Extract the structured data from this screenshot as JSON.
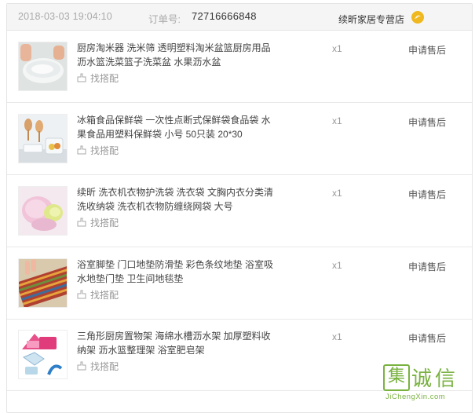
{
  "order": {
    "date": "2018-03-03 19:04:10",
    "number_label": "订单号:",
    "number": "72716666848",
    "shop_name": "续昕家居专营店",
    "shop_icon": "shop-badge-icon"
  },
  "items": [
    {
      "title": "厨房淘米器 洗米筛 透明塑料淘米盆篮厨房用品沥水篮洗菜篮子洗菜盆 水果沥水盆",
      "match": "找搭配",
      "qty": "x1",
      "action": "申请售后"
    },
    {
      "title": "冰箱食品保鲜袋 一次性点断式保鲜袋食品袋 水果食品用塑料保鲜袋 小号 50只装 20*30",
      "match": "找搭配",
      "qty": "x1",
      "action": "申请售后"
    },
    {
      "title": "续昕 洗衣机衣物护洗袋 洗衣袋 文胸内衣分类清洗收纳袋 洗衣机衣物防缠绕网袋 大号",
      "match": "找搭配",
      "qty": "x1",
      "action": "申请售后"
    },
    {
      "title": "浴室脚垫 门口地垫防滑垫 彩色条纹地垫 浴室吸水地垫门垫 卫生间地毯垫",
      "match": "找搭配",
      "qty": "x1",
      "action": "申请售后"
    },
    {
      "title": "三角形厨房置物架 海绵水槽沥水架 加厚塑料收纳架 沥水篮整理架 浴室肥皂架",
      "match": "找搭配",
      "qty": "x1",
      "action": "申请售后"
    }
  ],
  "watermark": {
    "logo_char": "集",
    "name": "诚信",
    "url": "JiChengXin.com"
  }
}
